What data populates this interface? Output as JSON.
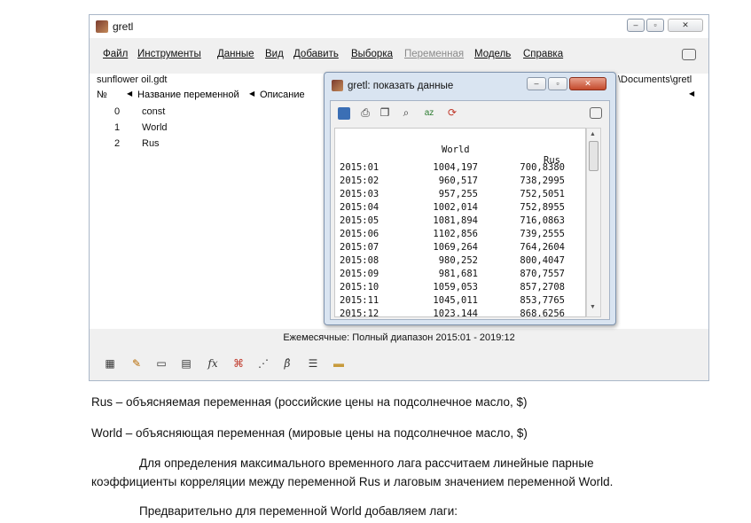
{
  "main_window": {
    "title": "gretl",
    "menu": [
      "Файл",
      "Инструменты",
      "Данные",
      "Вид",
      "Добавить",
      "Выборка",
      "Переменная",
      "Модель",
      "Справка"
    ],
    "disabled_menu": "Переменная",
    "file_name": "sunflower oil.gdt",
    "path": "\\Documents\\gretl",
    "columns": {
      "num": "№",
      "name": "Название переменной",
      "desc": "Описание"
    },
    "variables": [
      {
        "num": "0",
        "name": "const"
      },
      {
        "num": "1",
        "name": "World"
      },
      {
        "num": "2",
        "name": "Rus"
      }
    ],
    "status": "Ежемесячные: Полный диапазон 2015:01 - 2019:12",
    "toolbar_icons": [
      "calculator-icon",
      "edit-icon",
      "terminal-icon",
      "grid-icon",
      "fx-icon",
      "network-icon",
      "scatter-icon",
      "beta-icon",
      "database-icon",
      "folder-icon"
    ]
  },
  "data_window": {
    "title": "gretl: показать данные",
    "headers": {
      "world": "World",
      "rus": "Rus"
    },
    "rows": [
      {
        "date": "2015:01",
        "world": "1004,197",
        "rus": "700,8380"
      },
      {
        "date": "2015:02",
        "world": "960,517",
        "rus": "738,2995"
      },
      {
        "date": "2015:03",
        "world": "957,255",
        "rus": "752,5051"
      },
      {
        "date": "2015:04",
        "world": "1002,014",
        "rus": "752,8955"
      },
      {
        "date": "2015:05",
        "world": "1081,894",
        "rus": "716,0863"
      },
      {
        "date": "2015:06",
        "world": "1102,856",
        "rus": "739,2555"
      },
      {
        "date": "2015:07",
        "world": "1069,264",
        "rus": "764,2604"
      },
      {
        "date": "2015:08",
        "world": "980,252",
        "rus": "800,4047"
      },
      {
        "date": "2015:09",
        "world": "981,681",
        "rus": "870,7557"
      },
      {
        "date": "2015:10",
        "world": "1059,053",
        "rus": "857,2708"
      },
      {
        "date": "2015:11",
        "world": "1045,011",
        "rus": "853,7765"
      },
      {
        "date": "2015:12",
        "world": "1023,144",
        "rus": "868,6256"
      }
    ]
  },
  "document": {
    "line1": "Rus – объясняемая переменная (российские цены на подсолнечное масло, $)",
    "line2": "World – объясняющая переменная (мировые цены на подсолнечное масло, $)",
    "line3": "Для определения максимального временного лага рассчитаем линейные парные",
    "line4": "коэффициенты корреляции между переменной Rus и лаговым значением переменной World.",
    "line5": "Предварительно для переменной World добавляем лаги:"
  }
}
